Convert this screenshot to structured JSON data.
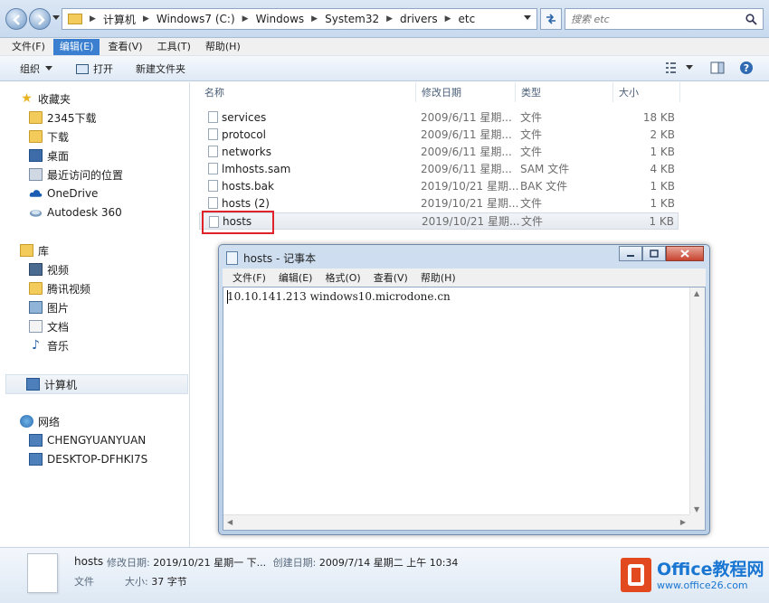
{
  "address_bar": {
    "breadcrumbs": [
      "计算机",
      "Windows7 (C:)",
      "Windows",
      "System32",
      "drivers",
      "etc"
    ],
    "search_placeholder": "搜索 etc"
  },
  "menubar": {
    "items": [
      "文件(F)",
      "编辑(E)",
      "查看(V)",
      "工具(T)",
      "帮助(H)"
    ],
    "active_index": 1
  },
  "toolbar": {
    "organize": "组织",
    "open": "打开",
    "new_folder": "新建文件夹"
  },
  "nav": {
    "favorites": {
      "label": "收藏夹",
      "items": [
        "2345下载",
        "下载",
        "桌面",
        "最近访问的位置",
        "OneDrive",
        "Autodesk 360"
      ]
    },
    "libraries": {
      "label": "库",
      "items": [
        "视频",
        "腾讯视频",
        "图片",
        "文档",
        "音乐"
      ]
    },
    "computer": "计算机",
    "network": {
      "label": "网络",
      "items": [
        "CHENGYUANYUAN",
        "DESKTOP-DFHKI7S"
      ]
    }
  },
  "columns": [
    "名称",
    "修改日期",
    "类型",
    "大小"
  ],
  "files": [
    {
      "name": "services",
      "date": "2009/6/11 星期...",
      "type": "文件",
      "size": "18 KB"
    },
    {
      "name": "protocol",
      "date": "2009/6/11 星期...",
      "type": "文件",
      "size": "2 KB"
    },
    {
      "name": "networks",
      "date": "2009/6/11 星期...",
      "type": "文件",
      "size": "1 KB"
    },
    {
      "name": "lmhosts.sam",
      "date": "2009/6/11 星期...",
      "type": "SAM 文件",
      "size": "4 KB"
    },
    {
      "name": "hosts.bak",
      "date": "2019/10/21 星期...",
      "type": "BAK 文件",
      "size": "1 KB"
    },
    {
      "name": "hosts (2)",
      "date": "2019/10/21 星期...",
      "type": "文件",
      "size": "1 KB"
    },
    {
      "name": "hosts",
      "date": "2019/10/21 星期...",
      "type": "文件",
      "size": "1 KB"
    }
  ],
  "notepad": {
    "title": "hosts - 记事本",
    "menu": [
      "文件(F)",
      "编辑(E)",
      "格式(O)",
      "查看(V)",
      "帮助(H)"
    ],
    "content": "10.10.141.213 windows10.microdone.cn"
  },
  "details": {
    "name": "hosts",
    "modified_label": "修改日期:",
    "modified_value": "2019/10/21 星期一 下...",
    "created_label": "创建日期:",
    "created_value": "2009/7/14 星期二 上午 10:34",
    "type": "文件",
    "size_label": "大小:",
    "size_value": "37 字节"
  },
  "watermark": {
    "main": "Office教程网",
    "sub": "www.office26.com"
  },
  "colors": {
    "menu_active": "#3a7fd0",
    "highlight_box": "#e0222a",
    "watermark_blue": "#1976d2",
    "watermark_orange": "#e2491f"
  }
}
